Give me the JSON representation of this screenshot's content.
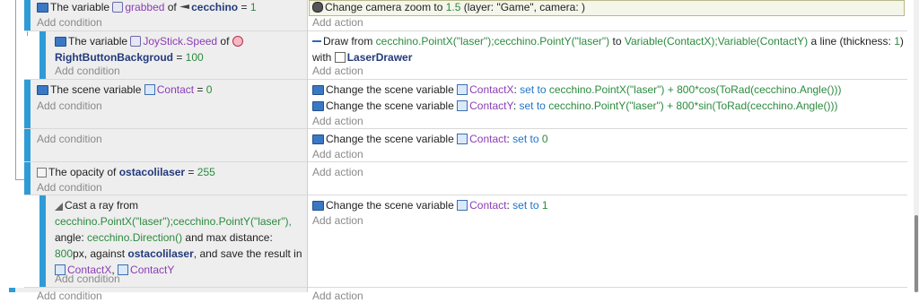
{
  "events": [
    {
      "conditions": [
        {
          "icon": "variable-icon",
          "parts": [
            {
              "t": "The variable ",
              "c": "dark"
            },
            {
              "t": "grabbed",
              "c": "purple",
              "icon": "object-variable-icon"
            },
            {
              "t": " of ",
              "c": "dark"
            },
            {
              "t": "cecchino",
              "c": "bold",
              "icon": "sprite-object-icon"
            },
            {
              "t": " = ",
              "c": "dark"
            },
            {
              "t": "1",
              "c": "green"
            }
          ]
        }
      ],
      "add_condition": "Add condition",
      "actions": [
        {
          "icon": "camera-icon",
          "parts": [
            {
              "t": "Change camera zoom to ",
              "c": "dark"
            },
            {
              "t": "1.5",
              "c": "green"
            },
            {
              "t": " (layer: \"Game\", camera: )",
              "c": "dark"
            }
          ]
        }
      ],
      "add_action": "Add action"
    },
    {
      "conditions": [
        {
          "icon": "variable-icon",
          "parts": [
            {
              "t": "The variable ",
              "c": "dark"
            },
            {
              "t": "JoyStick.Speed",
              "c": "purple",
              "icon": "object-variable-icon"
            },
            {
              "t": " of ",
              "c": "dark"
            },
            {
              "t": "",
              "c": "dark",
              "icon": "circle-object-icon"
            }
          ]
        },
        {
          "icon": "",
          "parts": [
            {
              "t": "RightButtonBackgroud",
              "c": "bold"
            },
            {
              "t": " = ",
              "c": "dark"
            },
            {
              "t": "100",
              "c": "green"
            }
          ]
        }
      ],
      "add_condition": "Add condition",
      "actions": [
        {
          "icon": "line-icon",
          "parts": [
            {
              "t": "Draw from ",
              "c": "dark"
            },
            {
              "t": "cecchino.PointX(\"laser\");cecchino.PointY(\"laser\")",
              "c": "green"
            },
            {
              "t": " to ",
              "c": "dark"
            },
            {
              "t": "Variable(ContactX);Variable(ContactY)",
              "c": "green"
            },
            {
              "t": " a line (thickness: ",
              "c": "dark"
            },
            {
              "t": "1",
              "c": "green"
            },
            {
              "t": ")",
              "c": "dark"
            }
          ]
        },
        {
          "icon": "",
          "parts": [
            {
              "t": "with ",
              "c": "dark"
            },
            {
              "t": "LaserDrawer",
              "c": "bold",
              "icon": "drawer-object-icon"
            }
          ]
        }
      ],
      "add_action": "Add action"
    },
    {
      "conditions": [
        {
          "icon": "variable-icon",
          "parts": [
            {
              "t": "The scene variable ",
              "c": "dark"
            },
            {
              "t": "Contact",
              "c": "purple",
              "icon": "scene-variable-icon"
            },
            {
              "t": " = ",
              "c": "dark"
            },
            {
              "t": "0",
              "c": "green"
            }
          ]
        }
      ],
      "add_condition": "Add condition",
      "actions": [
        {
          "icon": "variable-icon",
          "parts": [
            {
              "t": "Change the scene variable ",
              "c": "dark"
            },
            {
              "t": "ContactX",
              "c": "purple",
              "icon": "scene-variable-icon"
            },
            {
              "t": ": ",
              "c": "dark"
            },
            {
              "t": "set to",
              "c": "blue"
            },
            {
              "t": " ",
              "c": "dark"
            },
            {
              "t": "cecchino.PointX(\"laser\") + 800*cos(ToRad(cecchino.Angle()))",
              "c": "green"
            }
          ]
        },
        {
          "icon": "variable-icon",
          "parts": [
            {
              "t": "Change the scene variable ",
              "c": "dark"
            },
            {
              "t": "ContactY",
              "c": "purple",
              "icon": "scene-variable-icon"
            },
            {
              "t": ": ",
              "c": "dark"
            },
            {
              "t": "set to",
              "c": "blue"
            },
            {
              "t": " ",
              "c": "dark"
            },
            {
              "t": "cecchino.PointY(\"laser\") + 800*sin(ToRad(cecchino.Angle()))",
              "c": "green"
            }
          ]
        }
      ],
      "add_action": "Add action"
    },
    {
      "conditions": [],
      "add_condition": "Add condition",
      "actions": [
        {
          "icon": "variable-icon",
          "parts": [
            {
              "t": "Change the scene variable ",
              "c": "dark"
            },
            {
              "t": "Contact",
              "c": "purple",
              "icon": "scene-variable-icon"
            },
            {
              "t": ": ",
              "c": "dark"
            },
            {
              "t": "set to",
              "c": "blue"
            },
            {
              "t": " ",
              "c": "dark"
            },
            {
              "t": "0",
              "c": "green"
            }
          ]
        }
      ],
      "add_action": "Add action"
    },
    {
      "conditions": [
        {
          "icon": "opacity-icon",
          "parts": [
            {
              "t": "The opacity of ",
              "c": "dark"
            },
            {
              "t": "ostacolilaser",
              "c": "bold"
            },
            {
              "t": " = ",
              "c": "dark"
            },
            {
              "t": "255",
              "c": "green"
            }
          ]
        }
      ],
      "add_condition": "Add condition",
      "actions": [],
      "add_action": "Add action"
    },
    {
      "conditions": [
        {
          "icon": "raycast-icon",
          "parts": [
            {
              "t": "Cast a ray from",
              "c": "dark"
            }
          ]
        },
        {
          "icon": "",
          "parts": [
            {
              "t": "cecchino.PointX(\"laser\");cecchino.PointY(\"laser\"),",
              "c": "green"
            }
          ]
        },
        {
          "icon": "",
          "parts": [
            {
              "t": "angle: ",
              "c": "dark"
            },
            {
              "t": "cecchino.Direction()",
              "c": "green"
            },
            {
              "t": " and max distance:",
              "c": "dark"
            }
          ]
        },
        {
          "icon": "",
          "parts": [
            {
              "t": "800",
              "c": "green"
            },
            {
              "t": "px, against ",
              "c": "dark"
            },
            {
              "t": "ostacolilaser",
              "c": "bold"
            },
            {
              "t": ", and save the result in",
              "c": "dark"
            }
          ]
        },
        {
          "icon": "",
          "parts": [
            {
              "t": "ContactX",
              "c": "purple",
              "icon": "scene-variable-icon"
            },
            {
              "t": ", ",
              "c": "dark"
            },
            {
              "t": "ContactY",
              "c": "purple",
              "icon": "scene-variable-icon"
            }
          ]
        }
      ],
      "add_condition": "Add condition",
      "actions": [
        {
          "icon": "variable-icon",
          "parts": [
            {
              "t": "Change the scene variable ",
              "c": "dark"
            },
            {
              "t": "Contact",
              "c": "purple",
              "icon": "scene-variable-icon"
            },
            {
              "t": ": ",
              "c": "dark"
            },
            {
              "t": "set to",
              "c": "blue"
            },
            {
              "t": " ",
              "c": "dark"
            },
            {
              "t": "1",
              "c": "green"
            }
          ]
        }
      ],
      "add_action": "Add action"
    },
    {
      "conditions": [],
      "add_condition": "Add condition",
      "actions": [],
      "add_action": "Add action"
    }
  ]
}
